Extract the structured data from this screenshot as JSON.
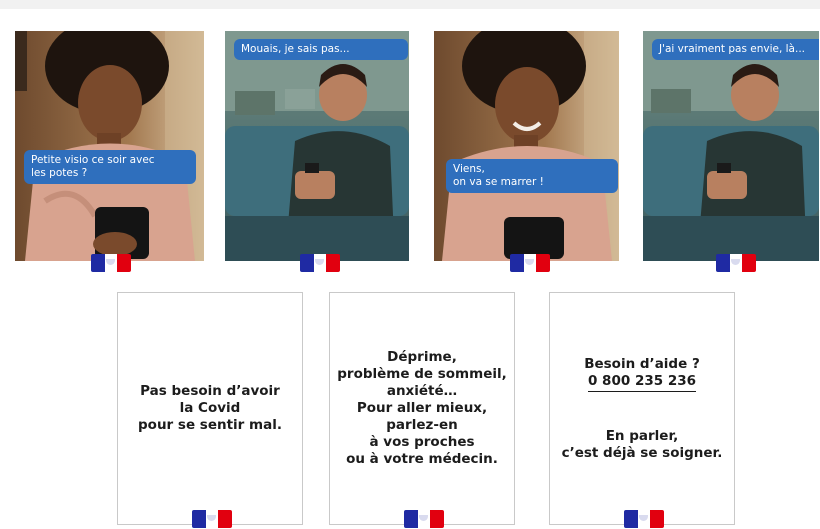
{
  "storyboard": {
    "panels": [
      {
        "type": "woman",
        "bubble": "Petite visio ce soir avec\nles potes ?"
      },
      {
        "type": "man",
        "bubble": "Mouais, je sais pas..."
      },
      {
        "type": "woman",
        "bubble": "Viens,\non va se marrer !"
      },
      {
        "type": "man",
        "bubble": "J'ai vraiment pas envie, là..."
      }
    ]
  },
  "cards": [
    {
      "text": "Pas besoin d’avoir\nla Covid\npour se sentir mal."
    },
    {
      "text": "Déprime,\nproblème de sommeil,\nanxiété…\nPour aller mieux,\nparlez-en\nà vos proches\nou à votre médecin."
    },
    {
      "title": "Besoin d’aide ?",
      "phone": "0 800 235 236",
      "text": "En parler,\nc’est déjà se soigner."
    }
  ],
  "icons": {
    "flag": "french-republic-flag-logo"
  },
  "colors": {
    "bubble": "#2f6fbd",
    "flag_blue": "#1f2aa3",
    "flag_red": "#e1000f"
  }
}
